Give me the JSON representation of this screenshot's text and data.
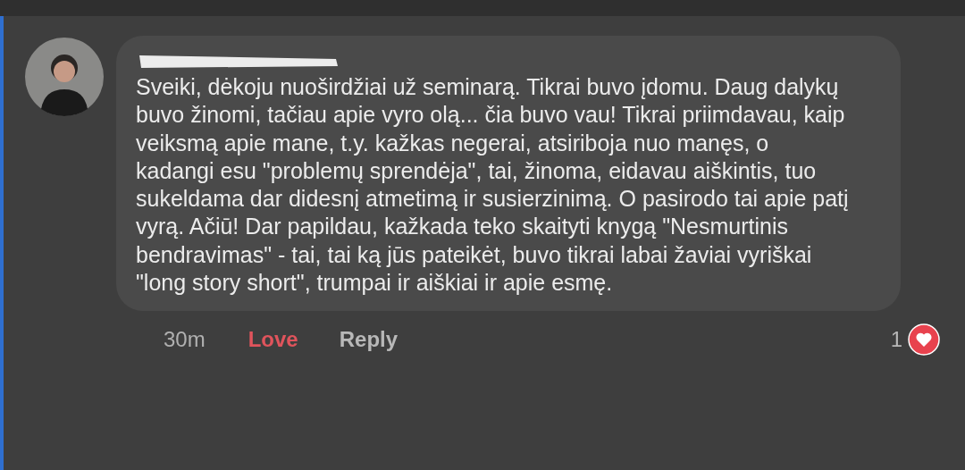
{
  "comment": {
    "author_redacted": true,
    "text": "Sveiki, dėkoju nuoširdžiai už seminarą. Tikrai buvo įdomu. Daug dalykų buvo žinomi, tačiau apie vyro olą... čia buvo vau! Tikrai priimdavau, kaip veiksmą apie mane, t.y. kažkas negerai, atsiriboja nuo manęs, o kadangi esu \"problemų sprendėja\", tai, žinoma, eidavau aiškintis, tuo sukeldama dar didesnį atmetimą ir susierzinimą. O pasirodo tai apie patį vyrą. Ačiū! Dar papildau, kažkada teko skaityti knygą \"Nesmurtinis bendravimas\" - tai, tai ką jūs pateikėt, buvo tikrai labai žaviai vyriškai \"long story short\", trumpai ir aiškiai ir apie esmę.",
    "time": "30m",
    "actions": [
      {
        "label": "Love",
        "selected": true
      },
      {
        "label": "Reply",
        "selected": false
      }
    ],
    "reaction_count": "1"
  }
}
